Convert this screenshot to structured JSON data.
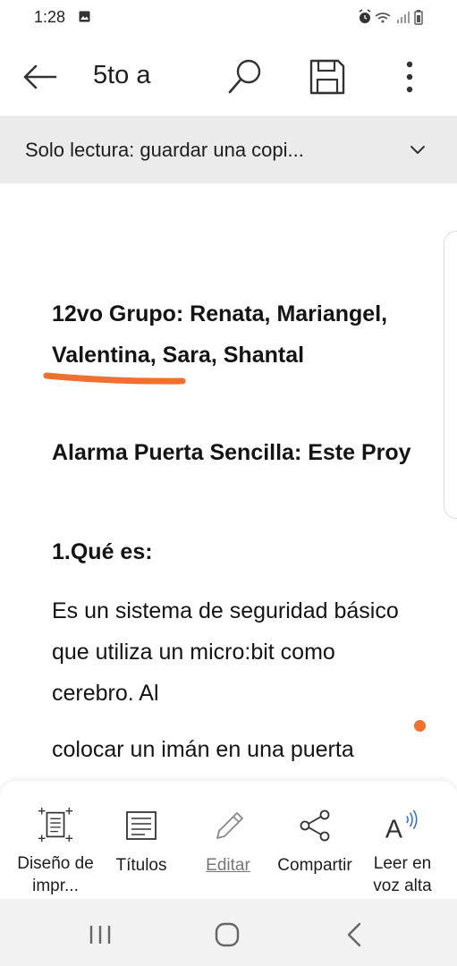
{
  "status_bar": {
    "time": "1:28",
    "icons": [
      "image-icon",
      "alarm-icon",
      "wifi-icon",
      "signal-icon",
      "battery-icon"
    ]
  },
  "app_bar": {
    "title": "5to a",
    "icons": [
      "back-arrow-icon",
      "search-icon",
      "save-icon",
      "more-vert-icon"
    ]
  },
  "banner": {
    "text": "Solo lectura: guardar una copi...",
    "icon": "chevron-down-icon"
  },
  "document": {
    "group_line": "12vo Grupo: Renata, Mariangel, Valentina, Sara, Shantal",
    "title_line": "Alarma Puerta Sencilla: Este Proy",
    "heading": "1.Qué es:",
    "body_1": "Es un sistema de seguridad básico que utiliza un micro:bit como cerebro. Al",
    "body_2": "colocar un imán en una puerta",
    "annotation_color": "#f07030"
  },
  "toolbar": {
    "items": [
      {
        "label": "Diseño de impr...",
        "icon": "print-layout-icon"
      },
      {
        "label": "Títulos",
        "icon": "headings-icon"
      },
      {
        "label": "Editar",
        "icon": "pencil-icon"
      },
      {
        "label": "Compartir",
        "icon": "share-icon"
      },
      {
        "label": "Leer en voz alta",
        "icon": "read-aloud-icon"
      }
    ]
  },
  "nav_bar": {
    "icons": [
      "recent-apps-icon",
      "home-icon",
      "back-icon"
    ]
  }
}
